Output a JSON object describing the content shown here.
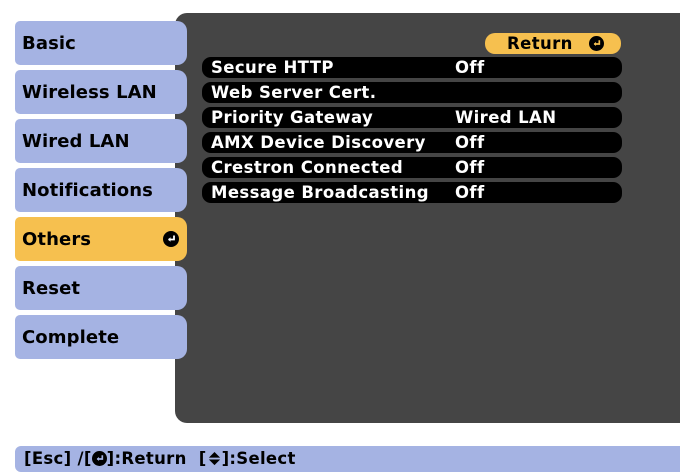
{
  "sidebar": {
    "items": [
      {
        "label": "Basic",
        "selected": false
      },
      {
        "label": "Wireless LAN",
        "selected": false
      },
      {
        "label": "Wired LAN",
        "selected": false
      },
      {
        "label": "Notifications",
        "selected": false
      },
      {
        "label": "Others",
        "selected": true,
        "icon": "enter-icon"
      },
      {
        "label": "Reset",
        "selected": false
      },
      {
        "label": "Complete",
        "selected": false
      }
    ]
  },
  "main": {
    "return_label": "Return",
    "return_icon": "enter-icon",
    "rows": [
      {
        "label": "Secure HTTP",
        "value": "Off"
      },
      {
        "label": "Web Server Cert.",
        "value": ""
      },
      {
        "label": "Priority Gateway",
        "value": "Wired LAN"
      },
      {
        "label": "AMX Device Discovery",
        "value": "Off"
      },
      {
        "label": "Crestron Connected",
        "value": "Off"
      },
      {
        "label": "Message Broadcasting",
        "value": "Off"
      }
    ]
  },
  "help": {
    "esc": "[Esc] /[",
    "return_text": "]:Return  [",
    "select_text": "]:Select",
    "icons": [
      "enter-icon",
      "up-down-arrow-icon"
    ]
  },
  "colors": {
    "tab": "#a5b3e3",
    "selected": "#f6c04f",
    "panel": "#454545",
    "row": "#000000",
    "row_text": "#ffffff"
  }
}
